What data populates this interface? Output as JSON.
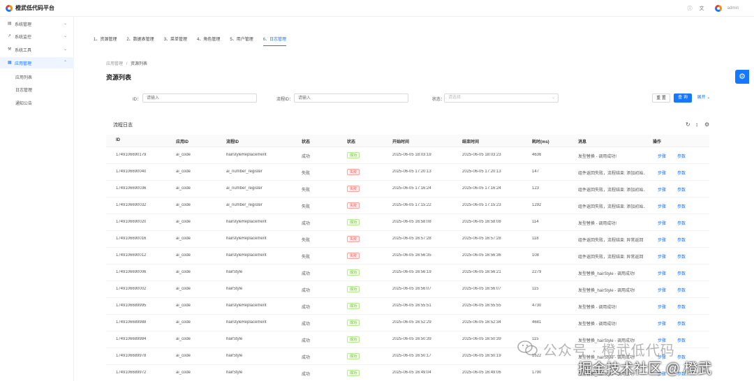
{
  "app": {
    "title": "橙武低代码平台"
  },
  "header": {
    "help_icon": "question-circle-icon",
    "translate_icon": "translate-icon",
    "user_name": "admin"
  },
  "sidebar": {
    "items": [
      {
        "label": "系统管理",
        "icon": "table-icon",
        "expanded": false
      },
      {
        "label": "系统监控",
        "icon": "chart-icon",
        "expanded": false
      },
      {
        "label": "系统工具",
        "icon": "wrench-icon",
        "expanded": false
      },
      {
        "label": "应用管理",
        "icon": "app-icon",
        "expanded": true,
        "active": true
      }
    ],
    "sub_items": [
      {
        "label": "应用列表"
      },
      {
        "label": "日志管理"
      },
      {
        "label": "通知公告"
      }
    ]
  },
  "tabs": [
    {
      "label": "1、资源管理"
    },
    {
      "label": "2、数据表管理"
    },
    {
      "label": "3、菜单管理"
    },
    {
      "label": "4、角色管理"
    },
    {
      "label": "5、用户管理"
    },
    {
      "label": "6、日志管理",
      "active": true
    }
  ],
  "breadcrumb": {
    "parent": "应用管理",
    "separator": "/",
    "current": "资源列表"
  },
  "page": {
    "title": "资源列表"
  },
  "search": {
    "id_label": "ID：",
    "id_placeholder": "请输入",
    "flow_label": "流程ID：",
    "flow_placeholder": "请输入",
    "status_label": "状态：",
    "status_placeholder": "请选择",
    "reset_label": "重 置",
    "search_label": "查 询",
    "expand_label": "展开"
  },
  "table_section": {
    "title": "流程日志"
  },
  "table": {
    "columns": [
      "ID",
      "应用ID",
      "流程ID",
      "状态",
      "状态",
      "开始时间",
      "结束时间",
      "耗时(ms)",
      "消息",
      "操作"
    ],
    "step_label": "步骤",
    "param_label": "参数",
    "rows": [
      {
        "id": "1749106690179",
        "app": "ai_code",
        "flow": "hairstyleReplacement",
        "status": "成功",
        "tag": "成功",
        "ok": true,
        "start": "2025-06-05 18:03:19",
        "end": "2025-06-05 18:03:23",
        "cost": "4636",
        "msg": "发型替换 - 调用成功!"
      },
      {
        "id": "1749106690040",
        "app": "ai_code",
        "flow": "ai_number_register",
        "status": "失败",
        "tag": "失败",
        "ok": false,
        "start": "2025-06-05 17:20:13",
        "end": "2025-06-05 17:20:13",
        "cost": "147",
        "msg": "组件返回失败，流程结束: 添加初始..."
      },
      {
        "id": "1749106690036",
        "app": "ai_code",
        "flow": "ai_number_register",
        "status": "失败",
        "tag": "失败",
        "ok": false,
        "start": "2025-06-05 17:16:24",
        "end": "2025-06-05 17:16:24",
        "cost": "123",
        "msg": "组件返回失败，流程结束: 添加初始..."
      },
      {
        "id": "1749106690032",
        "app": "ai_code",
        "flow": "ai_number_register",
        "status": "失败",
        "tag": "失败",
        "ok": false,
        "start": "2025-06-05 17:15:22",
        "end": "2025-06-05 17:15:23",
        "cost": "1292",
        "msg": "组件返回失败，流程结束: 添加初始..."
      },
      {
        "id": "1749106690020",
        "app": "ai_code",
        "flow": "hairstyleReplacement",
        "status": "成功",
        "tag": "成功",
        "ok": true,
        "start": "2025-06-05 16:58:08",
        "end": "2025-06-05 16:58:08",
        "cost": "114",
        "msg": "发型替换 - 调用成功!"
      },
      {
        "id": "1749106690016",
        "app": "ai_code",
        "flow": "hairstyleReplacement",
        "status": "失败",
        "tag": "失败",
        "ok": false,
        "start": "2025-06-05 16:57:28",
        "end": "2025-06-05 16:57:28",
        "cost": "118",
        "msg": "组件返回失败，流程结束: 异常返回"
      },
      {
        "id": "1749106690012",
        "app": "ai_code",
        "flow": "hairstyleReplacement",
        "status": "失败",
        "tag": "失败",
        "ok": false,
        "start": "2025-06-05 16:56:35",
        "end": "2025-06-05 16:56:36",
        "cost": "108",
        "msg": "组件返回失败，流程结束: 异常返回"
      },
      {
        "id": "1749106690006",
        "app": "ai_code",
        "flow": "hairStyle",
        "status": "成功",
        "tag": "成功",
        "ok": true,
        "start": "2025-06-05 16:56:19",
        "end": "2025-06-05 16:56:21",
        "cost": "2279",
        "msg": "发型替换_hairStyle - 调用成功!"
      },
      {
        "id": "1749106690002",
        "app": "ai_code",
        "flow": "hairStyle",
        "status": "成功",
        "tag": "成功",
        "ok": true,
        "start": "2025-06-05 16:56:07",
        "end": "2025-06-05 16:56:07",
        "cost": "115",
        "msg": "发型替换_hairStyle - 调用成功!"
      },
      {
        "id": "1749106689995",
        "app": "ai_code",
        "flow": "hairstyleReplacement",
        "status": "成功",
        "tag": "成功",
        "ok": true,
        "start": "2025-06-05 16:55:51",
        "end": "2025-06-05 16:55:55",
        "cost": "4730",
        "msg": "发型替换 - 调用成功!"
      },
      {
        "id": "1749106689988",
        "app": "ai_code",
        "flow": "hairstyleReplacement",
        "status": "成功",
        "tag": "成功",
        "ok": true,
        "start": "2025-06-05 16:52:29",
        "end": "2025-06-05 16:52:34",
        "cost": "4681",
        "msg": "发型替换 - 调用成功!"
      },
      {
        "id": "1749106689984",
        "app": "ai_code",
        "flow": "hairStyle",
        "status": "成功",
        "tag": "成功",
        "ok": true,
        "start": "2025-06-05 16:50:39",
        "end": "2025-06-05 16:50:39",
        "cost": "115",
        "msg": "发型替换_hairStyle - 调用成功!"
      },
      {
        "id": "1749106689978",
        "app": "ai_code",
        "flow": "hairStyle",
        "status": "成功",
        "tag": "成功",
        "ok": true,
        "start": "2025-06-05 16:50:17",
        "end": "2025-06-05 16:50:19",
        "cost": "1622",
        "msg": "发型替换_hairStyle - 调用成功!"
      },
      {
        "id": "1749106689972",
        "app": "ai_code",
        "flow": "hairStyle",
        "status": "成功",
        "tag": "成功",
        "ok": true,
        "start": "2025-06-05 16:49:04",
        "end": "2025-06-05 16:49:06",
        "cost": "1790",
        "msg": "发型替换_hairStyle - 调用成功!"
      }
    ]
  },
  "watermark": {
    "line1": "公众号 · 橙武低代码",
    "line2": "掘金技术社区 @ 橙武"
  }
}
